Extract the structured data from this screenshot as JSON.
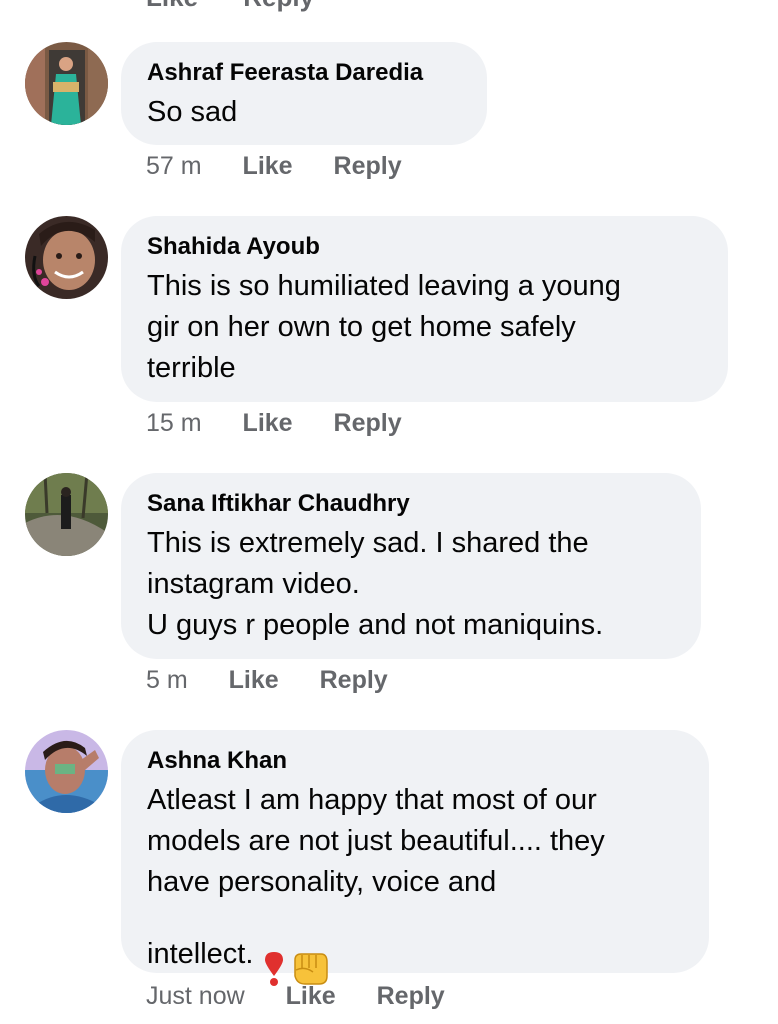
{
  "top_actions": [
    "Like",
    "Reply"
  ],
  "comments": [
    {
      "author": "Ashraf Feerasta Daredia",
      "text": "So sad",
      "time": "57 m",
      "like": "Like",
      "reply": "Reply"
    },
    {
      "author": "Shahida Ayoub",
      "text": "This is so humiliated  leaving a young\ngir on her own to get home safely\nterrible",
      "time": "15 m",
      "like": "Like",
      "reply": "Reply"
    },
    {
      "author": "Sana Iftikhar Chaudhry",
      "text": "This is extremely sad. I shared the\ninstagram video.\nU guys r people and not maniquins.",
      "time": "5 m",
      "like": "Like",
      "reply": "Reply"
    },
    {
      "author": "Ashna Khan",
      "text": "Atleast I am happy that most of our\nmodels are not just beautiful.... they\nhave personality, voice and",
      "text_last": "intellect.",
      "emojis": [
        "heavy-exclamation-icon",
        "fist-icon"
      ],
      "time": "Just now",
      "like": "Like",
      "reply": "Reply"
    }
  ],
  "colors": {
    "bubble": "#f0f2f5",
    "meta": "#65676b",
    "text": "#050505"
  }
}
